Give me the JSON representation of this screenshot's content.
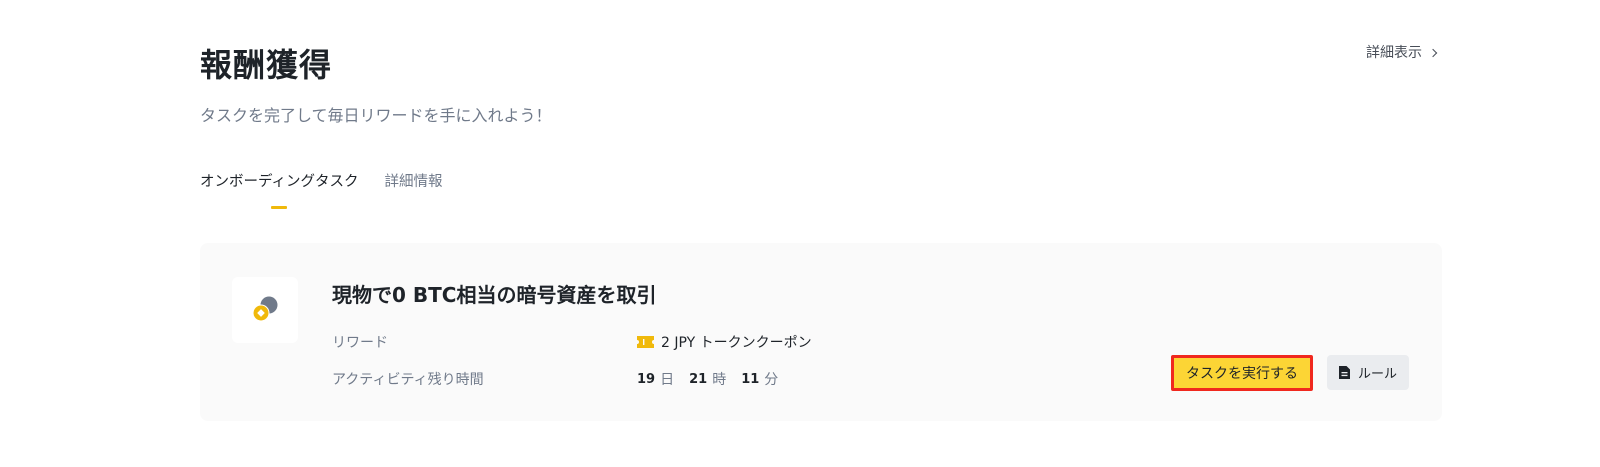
{
  "header": {
    "title": "報酬獲得",
    "subtitle": "タスクを完了して毎日リワードを手に入れよう！",
    "details_link": "詳細表示"
  },
  "tabs": [
    {
      "label": "オンボーディングタスク",
      "active": true
    },
    {
      "label": "詳細情報",
      "active": false
    }
  ],
  "task": {
    "title": "現物で0 BTC相当の暗号資産を取引",
    "reward_label": "リワード",
    "reward_value": "2 JPY トークンクーポン",
    "time_label": "アクティビティ残り時間",
    "time": {
      "days": "19",
      "days_unit": "日",
      "hours": "21",
      "hours_unit": "時",
      "minutes": "11",
      "minutes_unit": "分"
    },
    "do_task_button": "タスクを実行する",
    "rule_button": "ルール"
  },
  "colors": {
    "accent": "#fcd535",
    "underline": "#f0b90b",
    "highlight_border": "#f0281e"
  },
  "icons": {
    "details": "chevron-right-icon",
    "task": "coins-icon",
    "reward": "ticket-icon",
    "rule": "document-icon"
  }
}
